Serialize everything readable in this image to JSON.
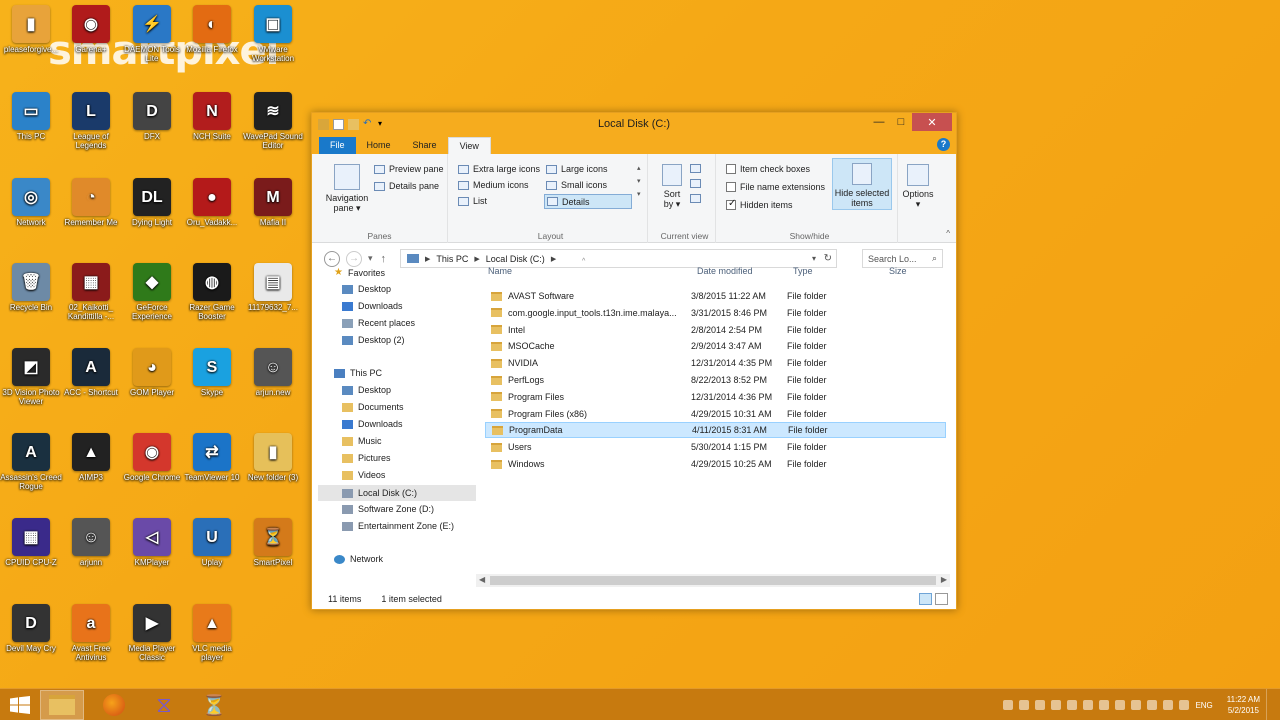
{
  "watermark": "smartpixel",
  "desktop_icons": [
    {
      "label": "pleaseforgive...",
      "color": "#e8a33a",
      "glyph": "▮"
    },
    {
      "label": "Garena+",
      "color": "#b01b1b",
      "glyph": "◉"
    },
    {
      "label": "DAEMON Tools Lite",
      "color": "#2a78c6",
      "glyph": "⚡"
    },
    {
      "label": "Mozilla Firefox",
      "color": "#e36b12",
      "glyph": "◐"
    },
    {
      "label": "VMware Workstation",
      "color": "#1b8fd1",
      "glyph": "▣"
    },
    {
      "label": "This PC",
      "color": "#2b82c9",
      "glyph": "▭"
    },
    {
      "label": "League of Legends",
      "color": "#1a3a6a",
      "glyph": "L"
    },
    {
      "label": "DFX",
      "color": "#444",
      "glyph": "D"
    },
    {
      "label": "NCH Suite",
      "color": "#b21d1d",
      "glyph": "N"
    },
    {
      "label": "WavePad Sound Editor",
      "color": "#222",
      "glyph": "≋"
    },
    {
      "label": "Network",
      "color": "#3a88c8",
      "glyph": "◎"
    },
    {
      "label": "Remember Me",
      "color": "#e08a2a",
      "glyph": "◔"
    },
    {
      "label": "Dying Light",
      "color": "#222",
      "glyph": "DL"
    },
    {
      "label": "Oru_Vadakk...",
      "color": "#b41a1a",
      "glyph": "●"
    },
    {
      "label": "Mafia II",
      "color": "#7a1b1b",
      "glyph": "M"
    },
    {
      "label": "Recycle Bin",
      "color": "#6d8aa6",
      "glyph": "🗑"
    },
    {
      "label": "02_Kaikotti_ Kandittilla -...",
      "color": "#8b1b1b",
      "glyph": "▦"
    },
    {
      "label": "GeForce Experience",
      "color": "#2f7a1a",
      "glyph": "◆"
    },
    {
      "label": "Razer Game Booster",
      "color": "#1a1a1a",
      "glyph": "◍"
    },
    {
      "label": "11179632_7...",
      "color": "#e9e9e9",
      "glyph": "▤"
    },
    {
      "label": "3D Vision Photo Viewer",
      "color": "#2a2a2a",
      "glyph": "◩"
    },
    {
      "label": "ACC - Shortcut",
      "color": "#1a2a3a",
      "glyph": "A"
    },
    {
      "label": "GOM Player",
      "color": "#e09a1a",
      "glyph": "◕"
    },
    {
      "label": "Skype",
      "color": "#1aa1e0",
      "glyph": "S"
    },
    {
      "label": "arjun.new",
      "color": "#555",
      "glyph": "☺"
    },
    {
      "label": "Assassin's Creed Rogue",
      "color": "#1a3040",
      "glyph": "A"
    },
    {
      "label": "AIMP3",
      "color": "#222",
      "glyph": "▲"
    },
    {
      "label": "Google Chrome",
      "color": "#d4372c",
      "glyph": "◉"
    },
    {
      "label": "TeamViewer 10",
      "color": "#1b74c8",
      "glyph": "⇄"
    },
    {
      "label": "New folder (3)",
      "color": "#e6c05a",
      "glyph": "▮"
    },
    {
      "label": "CPUID CPU-Z",
      "color": "#3a2a8a",
      "glyph": "▦"
    },
    {
      "label": "arjunn",
      "color": "#555",
      "glyph": "☺"
    },
    {
      "label": "KMPlayer",
      "color": "#6a4aa8",
      "glyph": "◁"
    },
    {
      "label": "Uplay",
      "color": "#2a6fb8",
      "glyph": "U"
    },
    {
      "label": "SmartPixel",
      "color": "#d47a1a",
      "glyph": "⏳"
    },
    {
      "label": "Devil May Cry",
      "color": "#333",
      "glyph": "D"
    },
    {
      "label": "Avast Free Antivirus",
      "color": "#e8731a",
      "glyph": "a"
    },
    {
      "label": "Media Player Classic",
      "color": "#333",
      "glyph": "▶"
    },
    {
      "label": "VLC media player",
      "color": "#e87a1a",
      "glyph": "▲"
    }
  ],
  "window": {
    "title": "Local Disk (C:)",
    "controls": {
      "minimize": "—",
      "maximize": "□",
      "close": "✕"
    },
    "tabs": [
      "File",
      "Home",
      "Share",
      "View"
    ],
    "active_tab": "View",
    "help": "?"
  },
  "ribbon": {
    "panes": {
      "navigation_pane": "Navigation pane ▾",
      "preview_pane": "Preview pane",
      "details_pane": "Details pane",
      "label": "Panes"
    },
    "layout": {
      "items": [
        "Extra large icons",
        "Large icons",
        "Medium icons",
        "Small icons",
        "List",
        "Details"
      ],
      "selected": "Details",
      "label": "Layout"
    },
    "current_view": {
      "sort_by": "Sort by ▾",
      "label": "Current view"
    },
    "show_hide": {
      "item_check_boxes": "Item check boxes",
      "file_name_extensions": "File name extensions",
      "hidden_items": "Hidden items",
      "hidden_items_checked": true,
      "hide_selected_items": "Hide selected items",
      "options": "Options ▾",
      "label": "Show/hide"
    }
  },
  "address": {
    "crumbs": [
      "This PC",
      "Local Disk (C:)"
    ],
    "search_placeholder": "Search Lo..."
  },
  "nav_pane": {
    "favorites": {
      "label": "Favorites",
      "items": [
        "Desktop",
        "Downloads",
        "Recent places",
        "Desktop (2)"
      ]
    },
    "this_pc": {
      "label": "This PC",
      "items": [
        "Desktop",
        "Documents",
        "Downloads",
        "Music",
        "Pictures",
        "Videos",
        "Local Disk (C:)",
        "Software Zone (D:)",
        "Entertainment Zone (E:)"
      ]
    },
    "selected": "Local Disk (C:)",
    "network": "Network"
  },
  "file_list": {
    "columns": [
      "Name",
      "Date modified",
      "Type",
      "Size"
    ],
    "rows": [
      {
        "name": "AVAST Software",
        "date": "3/8/2015 11:22 AM",
        "type": "File folder"
      },
      {
        "name": "com.google.input_tools.t13n.ime.malaya...",
        "date": "3/31/2015 8:46 PM",
        "type": "File folder"
      },
      {
        "name": "Intel",
        "date": "2/8/2014 2:54 PM",
        "type": "File folder"
      },
      {
        "name": "MSOCache",
        "date": "2/9/2014 3:47 AM",
        "type": "File folder"
      },
      {
        "name": "NVIDIA",
        "date": "12/31/2014 4:35 PM",
        "type": "File folder"
      },
      {
        "name": "PerfLogs",
        "date": "8/22/2013 8:52 PM",
        "type": "File folder"
      },
      {
        "name": "Program Files",
        "date": "12/31/2014 4:36 PM",
        "type": "File folder"
      },
      {
        "name": "Program Files (x86)",
        "date": "4/29/2015 10:31 AM",
        "type": "File folder"
      },
      {
        "name": "ProgramData",
        "date": "4/11/2015 8:31 AM",
        "type": "File folder"
      },
      {
        "name": "Users",
        "date": "5/30/2014 1:15 PM",
        "type": "File folder"
      },
      {
        "name": "Windows",
        "date": "4/29/2015 10:25 AM",
        "type": "File folder"
      }
    ],
    "selected": "ProgramData"
  },
  "status": {
    "count": "11 items",
    "selection": "1 item selected"
  },
  "taskbar": {
    "lang": "ENG",
    "time": "11:22 AM",
    "date": "5/2/2015"
  }
}
